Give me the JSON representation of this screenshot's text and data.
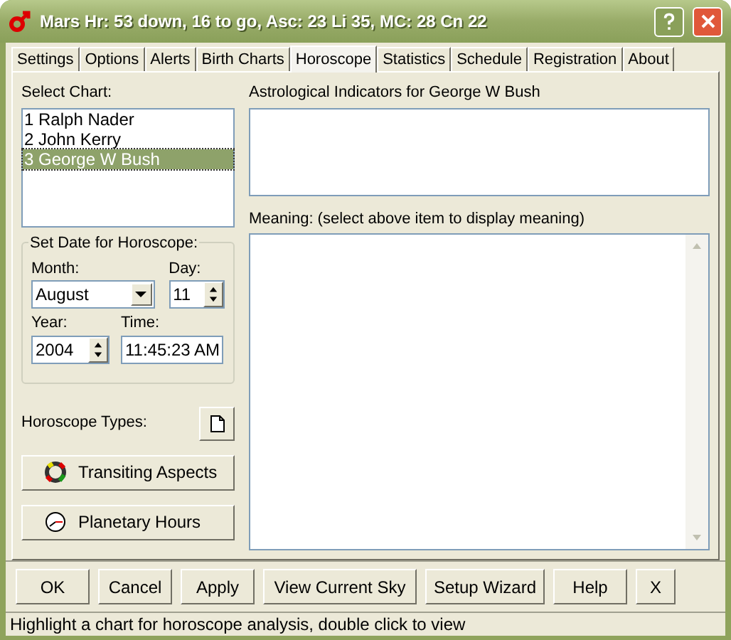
{
  "window": {
    "title": "Mars Hr: 53 down, 16 to go, Asc: 23 Li 35, MC: 28 Cn 22"
  },
  "tabs": [
    {
      "label": "Settings",
      "selected": false
    },
    {
      "label": "Options",
      "selected": false
    },
    {
      "label": "Alerts",
      "selected": false
    },
    {
      "label": "Birth Charts",
      "selected": false
    },
    {
      "label": "Horoscope",
      "selected": true
    },
    {
      "label": "Statistics",
      "selected": false
    },
    {
      "label": "Schedule",
      "selected": false
    },
    {
      "label": "Registration",
      "selected": false
    },
    {
      "label": "About",
      "selected": false
    }
  ],
  "chart_list": {
    "label": "Select Chart:",
    "items": [
      {
        "text": "1 Ralph Nader",
        "selected": false
      },
      {
        "text": "2 John Kerry",
        "selected": false
      },
      {
        "text": "3 George W Bush",
        "selected": true
      }
    ]
  },
  "date_group": {
    "title": "Set Date for Horoscope:",
    "month_label": "Month:",
    "month": "August",
    "day_label": "Day:",
    "day": "11",
    "year_label": "Year:",
    "year": "2004",
    "time_label": "Time:",
    "time": "11:45:23 AM"
  },
  "horoscope_types_label": "Horoscope Types:",
  "type_buttons": [
    {
      "label": "Transiting Aspects",
      "kind": "aspects"
    },
    {
      "label": "Planetary Hours",
      "kind": "clock"
    }
  ],
  "indicators": {
    "label": "Astrological Indicators for George W Bush"
  },
  "meaning": {
    "label": "Meaning: (select above item to display meaning)"
  },
  "buttons": [
    {
      "label": "OK"
    },
    {
      "label": "Cancel"
    },
    {
      "label": "Apply"
    },
    {
      "label": "View Current Sky"
    },
    {
      "label": "Setup Wizard"
    },
    {
      "label": "Help"
    },
    {
      "label": "X"
    }
  ],
  "status_bar": "Highlight a chart for horoscope analysis, double click to view"
}
